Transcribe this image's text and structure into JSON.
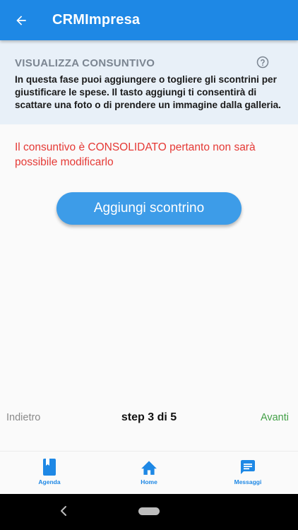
{
  "app_bar": {
    "title": "CRMImpresa",
    "back_icon": "arrow-left-icon"
  },
  "info_panel": {
    "title": "VISUALIZZA CONSUNTIVO",
    "help_icon": "help-circle-icon",
    "text": "In questa fase puoi aggiungere o togliere gli scontrini per giustificare le spese. Il tasto aggiungi ti consentirà di scattare una foto o di prendere un immagine dalla galleria."
  },
  "warning": "Il consuntivo è CONSOLIDATO pertanto non sarà possibile modificarlo",
  "add_button": "Aggiungi scontrino",
  "step_bar": {
    "prev": "Indietro",
    "step": "step 3 di 5",
    "next": "Avanti"
  },
  "bottom_nav": {
    "items": [
      {
        "label": "Agenda",
        "icon": "book-icon"
      },
      {
        "label": "Home",
        "icon": "home-icon"
      },
      {
        "label": "Messaggi",
        "icon": "message-icon"
      }
    ]
  },
  "colors": {
    "primary": "#1e88e5",
    "button": "#3d9ce8",
    "warning": "#e53935",
    "next": "#43a047",
    "panel_bg": "#e8f0f8"
  }
}
